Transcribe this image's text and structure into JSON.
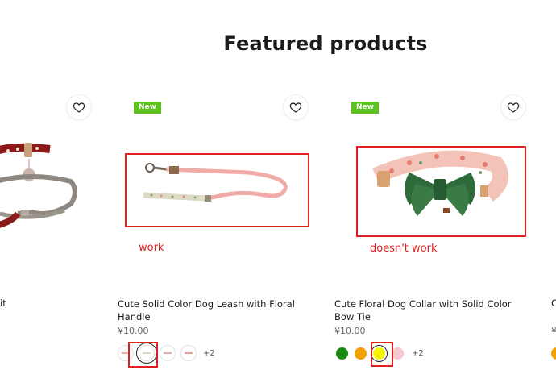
{
  "section": {
    "title": "Featured products"
  },
  "annotations": {
    "work": "work",
    "doesnt_work": "doesn't work"
  },
  "products": [
    {
      "title_fragment": "it"
    },
    {
      "badge": "New",
      "title": "Cute Solid Color Dog Leash with Floral Handle",
      "price": "¥10.00",
      "more_variants": "+2",
      "swatches": [
        "leash-pink",
        "leash-floral-selected",
        "leash-pink",
        "leash-pink"
      ]
    },
    {
      "badge": "New",
      "title": "Cute Floral Dog Collar with Solid Color Bow Tie",
      "price": "¥10.00",
      "more_variants": "+2",
      "swatches": [
        "#1a8a14",
        "#f0a000",
        "#f5f500",
        "#f8c8d0"
      ]
    },
    {
      "title_fragment": "C",
      "price_fragment": "¥"
    }
  ],
  "colors": {
    "badge": "#5dc21e",
    "annotation": "#e02020",
    "green": "#1a8a14",
    "orange": "#f0a000",
    "yellow": "#f5f500",
    "pink": "#f8c8d0"
  }
}
